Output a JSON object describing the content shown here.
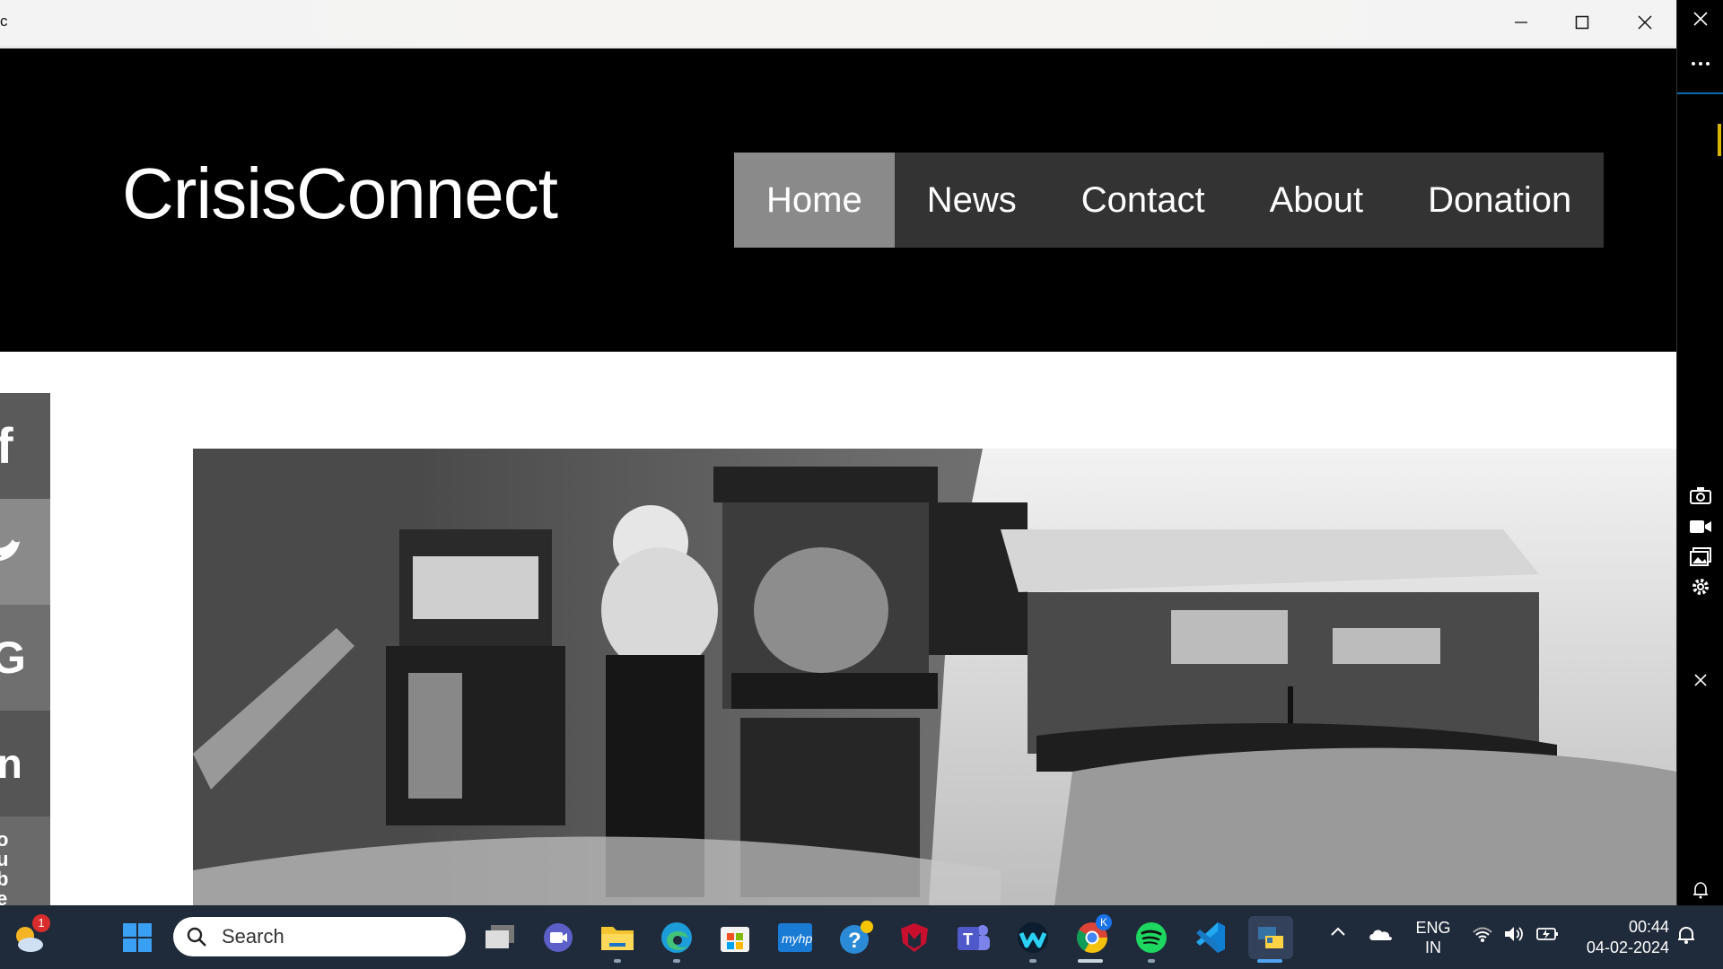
{
  "window": {
    "title": "c",
    "controls": {
      "minimize": "minimize",
      "maximize": "maximize",
      "close": "close"
    }
  },
  "site": {
    "logo": "CrisisConnect",
    "nav": [
      {
        "label": "Home",
        "active": true
      },
      {
        "label": "News",
        "active": false
      },
      {
        "label": "Contact",
        "active": false
      },
      {
        "label": "About",
        "active": false
      },
      {
        "label": "Donation",
        "active": false
      }
    ],
    "social": [
      {
        "name": "facebook",
        "glyph": "f"
      },
      {
        "name": "twitter",
        "glyph": "t"
      },
      {
        "name": "google",
        "glyph": "G"
      },
      {
        "name": "linkedin",
        "glyph": "in"
      },
      {
        "name": "youtube",
        "glyph": "ou be"
      }
    ],
    "hero_image": "grayscale street traffic photo"
  },
  "side_panel": {
    "icons": [
      "close-icon",
      "more-icon",
      "camera-icon",
      "video-icon",
      "gallery-icon",
      "gear-icon",
      "close-icon",
      "bell-icon"
    ]
  },
  "taskbar": {
    "search_placeholder": "Search",
    "weather_badge": "1",
    "chrome_badge": "K",
    "language_top": "ENG",
    "language_bottom": "IN",
    "time": "00:44",
    "date": "04-02-2024"
  },
  "colors": {
    "header_bg": "#000000",
    "nav_bg": "#333333",
    "nav_active": "#8a8a8a",
    "taskbar_bg": "#1f2a3a"
  }
}
